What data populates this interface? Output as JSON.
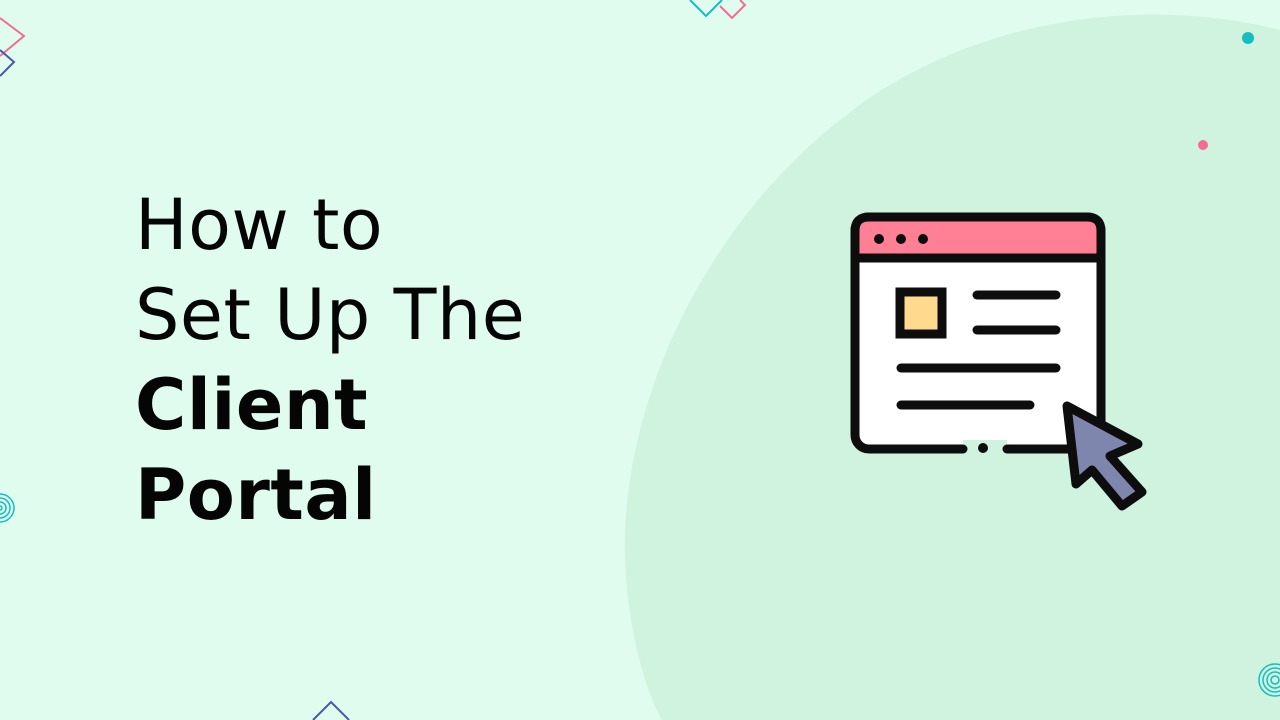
{
  "title": {
    "line1": "How to",
    "line2": "Set Up The",
    "line3": "Client",
    "line4": "Portal"
  },
  "icons": {
    "illustration": "browser-window-cursor-icon",
    "decorations": [
      "diamond-outline-icon",
      "dot-icon",
      "concentric-circle-icon"
    ]
  },
  "colors": {
    "background": "#e0fcee",
    "blob": "#d0f3e0",
    "window_header": "#ff7f95",
    "window_body": "#ffffff",
    "image_placeholder": "#ffd98e",
    "cursor": "#7f86ad",
    "outline": "#0d0d0d",
    "accent_teal": "#14bdc0",
    "accent_pink": "#f36a96",
    "accent_indigo": "#4a58a6"
  }
}
